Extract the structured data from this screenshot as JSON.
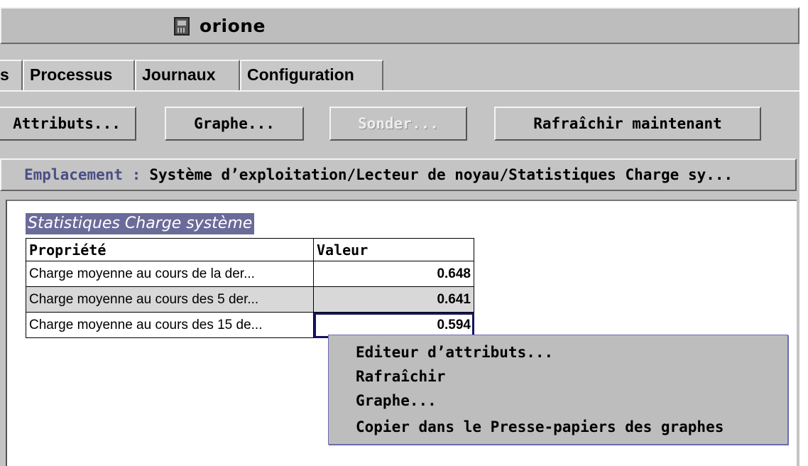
{
  "window": {
    "title": "orione",
    "icon": "calendar-icon"
  },
  "tabs": [
    {
      "label": "s"
    },
    {
      "label": "Processus"
    },
    {
      "label": "Journaux"
    },
    {
      "label": "Configuration"
    }
  ],
  "toolbar": {
    "attributes_label": "Attributs...",
    "graph_label": "Graphe...",
    "probe_label": "Sonder...",
    "refresh_now_label": "Rafraîchir maintenant"
  },
  "location": {
    "label": "Emplacement :",
    "path": "Système d’exploitation/Lecteur de noyau/Statistiques Charge sy..."
  },
  "section": {
    "title": "Statistiques Charge système",
    "columns": [
      "Propriété",
      "Valeur"
    ],
    "rows": [
      {
        "property": "Charge moyenne au cours de la der...",
        "value": "0.648"
      },
      {
        "property": "Charge moyenne au cours des 5 der...",
        "value": "0.641"
      },
      {
        "property": "Charge moyenne au cours des 15 de...",
        "value": "0.594"
      }
    ]
  },
  "context_menu": {
    "items": [
      "Editeur d’attributs...",
      "Rafraîchir",
      "Graphe...",
      "Copier dans le Presse-papiers des graphes"
    ]
  }
}
